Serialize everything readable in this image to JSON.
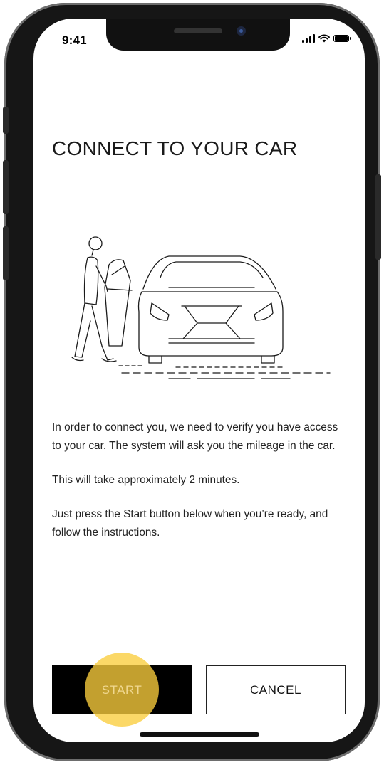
{
  "status_bar": {
    "time": "9:41",
    "icons": [
      "signal-icon",
      "wifi-icon",
      "battery-icon"
    ]
  },
  "page": {
    "title": "CONNECT TO YOUR CAR"
  },
  "illustration": {
    "name": "person-opening-car-door-illustration"
  },
  "body": {
    "paragraph_1": "In order to connect you, we need to verify you have access to your car. The system will ask you the mileage in the car.",
    "paragraph_2": "This will take approximately 2 minutes.",
    "paragraph_3": "Just press the Start button below when you’re ready, and follow the instructions."
  },
  "actions": {
    "start_label": "START",
    "cancel_label": "CANCEL"
  },
  "colors": {
    "start_bg": "#000000",
    "start_text": "#f0d890",
    "highlight": "#facd3c",
    "cancel_border": "#222222"
  }
}
